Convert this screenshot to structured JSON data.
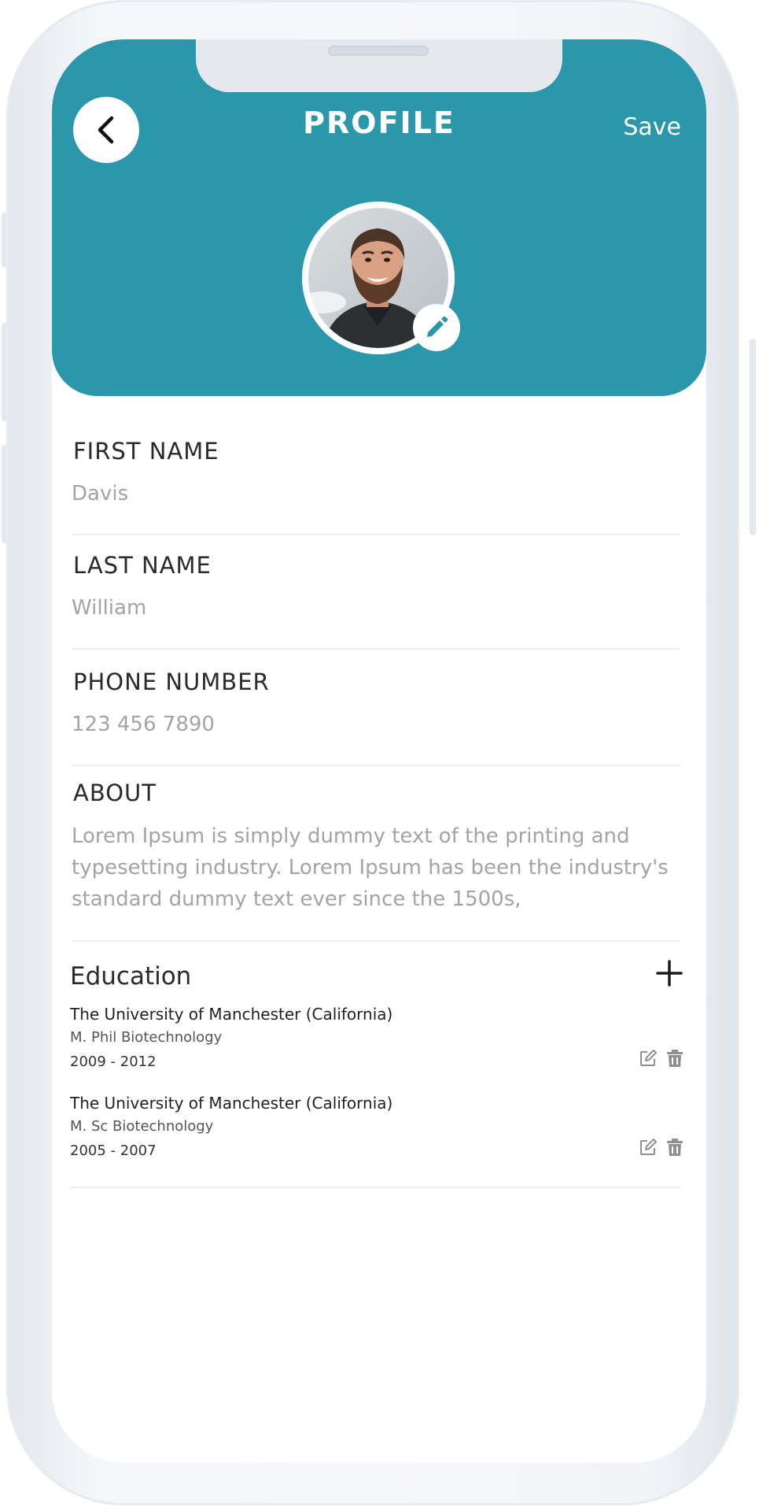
{
  "header": {
    "title": "PROFILE",
    "save_label": "Save",
    "accent_color": "#2b97ab"
  },
  "icons": {
    "back": "chevron-left-icon",
    "edit_photo": "pencil-icon",
    "add": "plus-icon",
    "edit": "edit-icon",
    "delete": "trash-icon"
  },
  "fields": {
    "first_name": {
      "label": "FIRST NAME",
      "value": "Davis"
    },
    "last_name": {
      "label": "LAST NAME",
      "value": "William"
    },
    "phone": {
      "label": "PHONE NUMBER",
      "value": "123 456 7890"
    },
    "about": {
      "label": "ABOUT",
      "value": "Lorem Ipsum is simply dummy text of the printing and typesetting industry. Lorem Ipsum has been the industry's standard dummy text ever since the 1500s,"
    }
  },
  "education": {
    "title": "Education",
    "items": [
      {
        "school": "The University of Manchester (California)",
        "degree": "M. Phil Biotechnology",
        "years": "2009 - 2012"
      },
      {
        "school": "The University of Manchester (California)",
        "degree": "M. Sc Biotechnology",
        "years": "2005 - 2007"
      }
    ]
  }
}
